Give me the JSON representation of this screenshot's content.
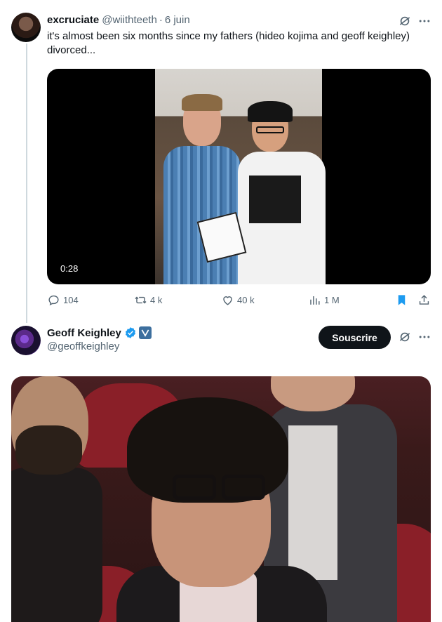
{
  "tweet1": {
    "author_name": "excruciate",
    "author_handle": "@wiithteeth",
    "separator": "·",
    "date": "6 juin",
    "text": "it's almost been six months since my fathers (hideo kojima and geoff keighley) divorced...",
    "video_duration": "0:28",
    "stats": {
      "replies": "104",
      "reposts": "4 k",
      "likes": "40 k",
      "views": "1 M"
    },
    "bookmarked": true
  },
  "tweet2": {
    "author_name": "Geoff Keighley",
    "author_handle": "@geoffkeighley",
    "subscribe_label": "Souscrire"
  },
  "colors": {
    "text_primary": "#0f1419",
    "text_secondary": "#536471",
    "accent": "#1d9bf0",
    "bookmark": "#1d9bf0"
  },
  "icons": {
    "reply": "reply-icon",
    "repost": "repost-icon",
    "like": "heart-icon",
    "views": "views-icon",
    "bookmark": "bookmark-icon",
    "share": "share-icon",
    "grok": "grok-icon",
    "more": "more-icon",
    "verified": "verified-icon",
    "affiliate": "affiliate-badge-icon"
  }
}
